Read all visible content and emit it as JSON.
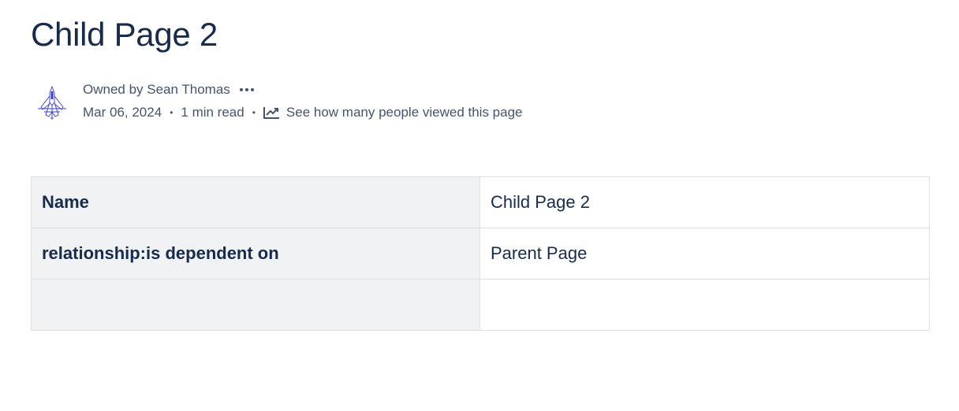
{
  "page": {
    "title": "Child Page 2"
  },
  "byline": {
    "owner_text": "Owned by Sean Thomas",
    "more_icon": "more-horizontal-icon",
    "date": "Mar 06, 2024",
    "separator": "•",
    "read_time": "1 min read",
    "views_icon": "line-chart-icon",
    "views_link": "See how many people viewed this page"
  },
  "properties_table": {
    "rows": [
      {
        "key": "Name",
        "value": "Child Page 2"
      },
      {
        "key": "relationship:is dependent on",
        "value": "Parent Page"
      },
      {
        "key": "",
        "value": ""
      }
    ]
  },
  "colors": {
    "text": "#172b4d",
    "subtle_text": "#44546f",
    "key_cell_bg": "#f1f2f4",
    "border": "#dcdfe4",
    "avatar_stroke": "#3a3dcc"
  }
}
